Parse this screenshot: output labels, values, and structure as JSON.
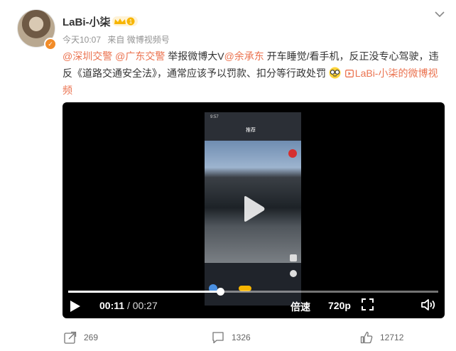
{
  "post": {
    "author": {
      "name": "LaBi-小柒",
      "vip_level": "1"
    },
    "meta": {
      "time": "今天10:07",
      "source": "来自 微博视频号"
    },
    "content": {
      "mention_1": "@深圳交警",
      "mention_2": "@广东交警",
      "text_1": " 举报微博大V",
      "mention_3": "@余承东",
      "text_2": " 开车睡觉/看手机，反正没专心驾驶，违反《道路交通安全法》，通常应该予以罚款、扣分等行政处罚",
      "video_link": "LaBi-小柒的微博视频"
    },
    "video": {
      "current_time": "00:11",
      "separator": "/",
      "duration": "00:27",
      "progress": 0.41,
      "speed_label": "倍速",
      "quality_label": "720p",
      "phone_time": "9:57",
      "phone_tab": "推荐"
    },
    "actions": {
      "share_count": "269",
      "comment_count": "1326",
      "like_count": "12712"
    }
  },
  "colors": {
    "link": "#eb7350",
    "badge": "#f28c28",
    "vip": "#f7b500"
  }
}
